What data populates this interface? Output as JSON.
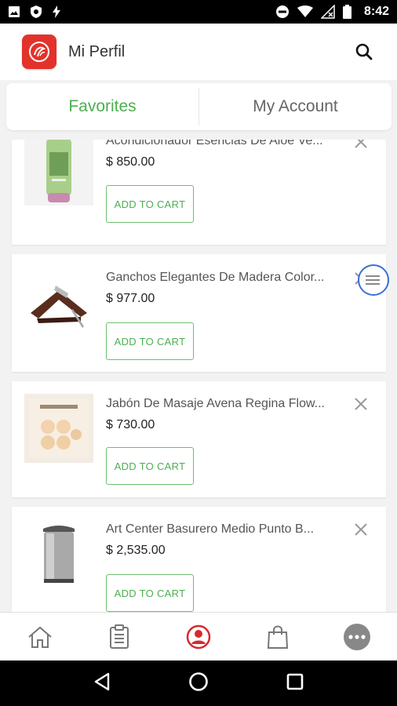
{
  "status_bar": {
    "time": "8:42",
    "left_icons": [
      "image-icon",
      "shield-icon",
      "bolt-icon"
    ],
    "right_icons": [
      "dnd-icon",
      "wifi-icon",
      "signal-off-icon",
      "battery-icon"
    ]
  },
  "header": {
    "title": "Mi Perfil",
    "logo_icon": "brand-logo",
    "search_icon": "search-icon"
  },
  "tabs": [
    {
      "label": "Favorites",
      "active": true
    },
    {
      "label": "My Account",
      "active": false
    }
  ],
  "favorites": [
    {
      "name": "Acondicionador Esencias De Aloe Ve...",
      "price": "$  850.00",
      "button": "ADD TO CART"
    },
    {
      "name": "Ganchos Elegantes De Madera Color...",
      "price": "$  977.00",
      "button": "ADD TO CART"
    },
    {
      "name": "Jabón De Masaje Avena Regina Flow...",
      "price": "$  730.00",
      "button": "ADD TO CART"
    },
    {
      "name": "Art Center Basurero Medio Punto B...",
      "price": "$  2,535.00",
      "button": "ADD TO CART"
    }
  ],
  "bottom_nav": [
    {
      "icon": "home-icon",
      "active": false
    },
    {
      "icon": "orders-icon",
      "active": false
    },
    {
      "icon": "profile-icon",
      "active": true
    },
    {
      "icon": "bag-icon",
      "active": false
    },
    {
      "icon": "more-icon",
      "active": false
    }
  ],
  "colors": {
    "accent": "#4caf50",
    "brand": "#e3322b"
  }
}
